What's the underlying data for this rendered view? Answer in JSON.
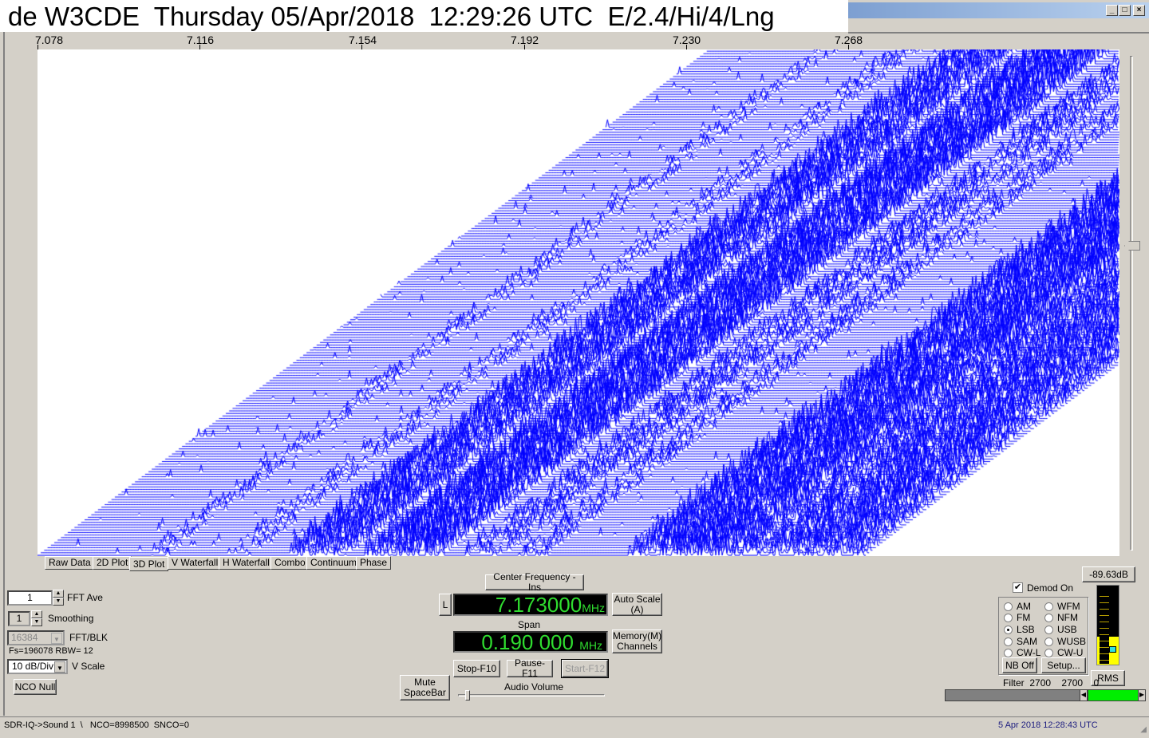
{
  "header": {
    "title": "de W3CDE  Thursday 05/Apr/2018  12:29:26 UTC  E/2.4/Hi/4/Lng"
  },
  "window": {
    "minimize": "_",
    "maximize": "□",
    "close": "×"
  },
  "axis": {
    "ticks": [
      "7.078",
      "7.116",
      "7.154",
      "7.192",
      "7.230",
      "7.268"
    ]
  },
  "plot": {
    "line_color": "#0000ff"
  },
  "tabs": [
    {
      "label": "Raw Data"
    },
    {
      "label": "2D Plot"
    },
    {
      "label": "3D Plot",
      "active": true
    },
    {
      "label": "V Waterfall"
    },
    {
      "label": "H Waterfall"
    },
    {
      "label": "Combo"
    },
    {
      "label": "Continuum"
    },
    {
      "label": "Phase"
    }
  ],
  "left_controls": {
    "fft_ave_value": "1",
    "fft_ave_label": "FFT Ave",
    "smoothing_value": "1",
    "smoothing_label": "Smoothing",
    "fft_blk_value": "16384",
    "fft_blk_label": "FFT/BLK",
    "fs_rbw": "Fs=196078 RBW=  12",
    "vscale_value": "10 dB/Div",
    "vscale_label": "V Scale",
    "nco_null": "NCO Null"
  },
  "center": {
    "center_freq_button": "Center Frequency - Ins",
    "l_button": "L",
    "frequency": "7.173000",
    "freq_unit": "MHz",
    "auto_scale": "Auto Scale (A)",
    "span_label": "Span",
    "span": "0.190 000",
    "span_unit": "MHz",
    "memory": "Memory(M) Channels",
    "stop": "Stop-F10",
    "pause": "Pause-F11",
    "start": "Start-F12",
    "mute": "Mute SpaceBar",
    "audio_volume": "Audio Volume",
    "audio_volume_level": 0.03
  },
  "demod": {
    "level": "-89.63dB",
    "demod_on": "Demod On",
    "modes": [
      "AM",
      "FM",
      "LSB",
      "SAM",
      "CW-L",
      "WFM",
      "NFM",
      "USB",
      "WUSB",
      "CW-U"
    ],
    "selected": "LSB",
    "nb_off": "NB Off",
    "setup": "Setup...",
    "rms": "RMS",
    "filter_label": "Filter",
    "filter_low": "2700",
    "filter_high": "2700",
    "filter_offset": "0",
    "meter_fill": 0.35
  },
  "status": {
    "left": "SDR-IQ->Sound 1  \\   NCO=8998500  SNCO=0",
    "right": "5 Apr 2018  12:28:43 UTC"
  }
}
